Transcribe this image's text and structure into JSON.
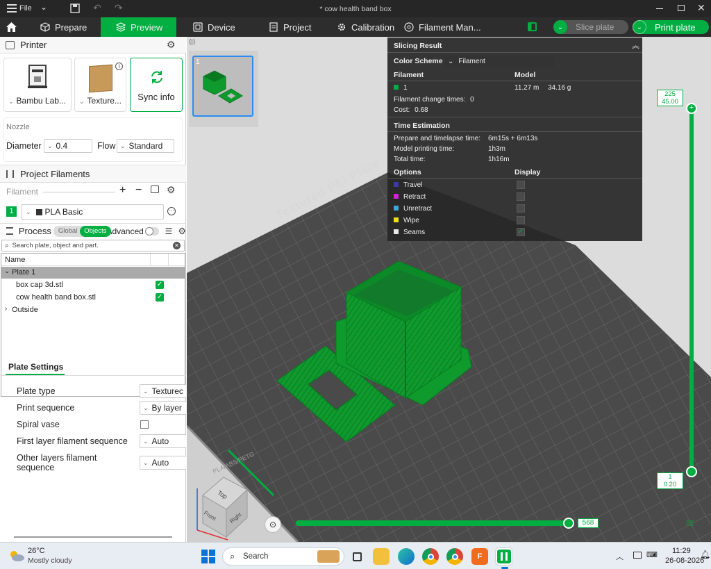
{
  "window": {
    "file_menu": "File",
    "title": "* cow health band box"
  },
  "tabs": [
    {
      "label": "Prepare"
    },
    {
      "label": "Preview"
    },
    {
      "label": "Device"
    },
    {
      "label": "Project"
    },
    {
      "label": "Calibration"
    },
    {
      "label": "Filament Man..."
    }
  ],
  "toolbar": {
    "slice_label": "Slice plate",
    "print_label": "Print plate"
  },
  "printer": {
    "heading": "Printer",
    "printer_name": "Bambu Lab...",
    "plate_name": "Texture...",
    "sync_label": "Sync info",
    "nozzle_heading": "Nozzle",
    "diameter_label": "Diameter",
    "diameter_value": "0.4",
    "flow_label": "Flow",
    "flow_value": "Standard"
  },
  "filaments": {
    "heading": "Project Filaments",
    "column": "Filament",
    "items": [
      {
        "index": "1",
        "name": "PLA Basic",
        "color": "#00ae42"
      }
    ]
  },
  "process": {
    "heading": "Process",
    "global_label": "Global",
    "objects_label": "Objects",
    "advanced_label": "Advanced",
    "search_placeholder": "Search plate, object and part."
  },
  "objects": {
    "header": "Name",
    "plate": "Plate 1",
    "items": [
      "box cap 3d.stl",
      "cow health band box.stl"
    ],
    "outside": "Outside"
  },
  "plate_settings": {
    "tab": "Plate Settings",
    "rows": [
      {
        "label": "Plate type",
        "value": "Texturec"
      },
      {
        "label": "Print sequence",
        "value": "By layer"
      },
      {
        "label": "Spiral vase",
        "value": ""
      },
      {
        "label": "First layer filament sequence",
        "value": "Auto"
      },
      {
        "label": "Other layers filament",
        "label2": "sequence",
        "value": "Auto"
      }
    ]
  },
  "thumbnail": {
    "number": "1"
  },
  "slicing": {
    "title": "Slicing Result",
    "color_scheme_label": "Color Scheme",
    "color_scheme_value": "Filament",
    "filament_header": "Filament",
    "model_header": "Model",
    "filament_index": "1",
    "filament_color": "#00ae42",
    "length": "11.27 m",
    "weight": "34.16 g",
    "change_label": "Filament change times:",
    "change_value": "0",
    "cost_label": "Cost:",
    "cost_value": "0.68",
    "time_heading": "Time Estimation",
    "prepare_label": "Prepare and timelapse time:",
    "prepare_value": "6m15s + 6m13s",
    "model_time_label": "Model printing time:",
    "model_time_value": "1h3m",
    "total_label": "Total time:",
    "total_value": "1h16m",
    "options_header": "Options",
    "display_header": "Display",
    "options": [
      {
        "name": "Travel",
        "color": "#3a3aa8"
      },
      {
        "name": "Retract",
        "color": "#d61fd6"
      },
      {
        "name": "Unretract",
        "color": "#3aa8d8"
      },
      {
        "name": "Wipe",
        "color": "#f0e010"
      },
      {
        "name": "Seams",
        "color": "#e8e8e8"
      }
    ]
  },
  "layers": {
    "top_layer": "225",
    "top_height": "45.00",
    "bottom_layer": "1",
    "bottom_height": "0.20",
    "moves_value": "568"
  },
  "plate_labels": {
    "top": "Textured PEI Plate",
    "side": "PLA/ABS/PETG"
  },
  "nav_cube": {
    "top": "Top",
    "front": "Front",
    "right": "Right"
  },
  "weather": {
    "temp": "26°C",
    "desc": "Mostly cloudy"
  },
  "taskbar": {
    "search": "Search",
    "time": "11:29",
    "date": "26-08-2026"
  }
}
